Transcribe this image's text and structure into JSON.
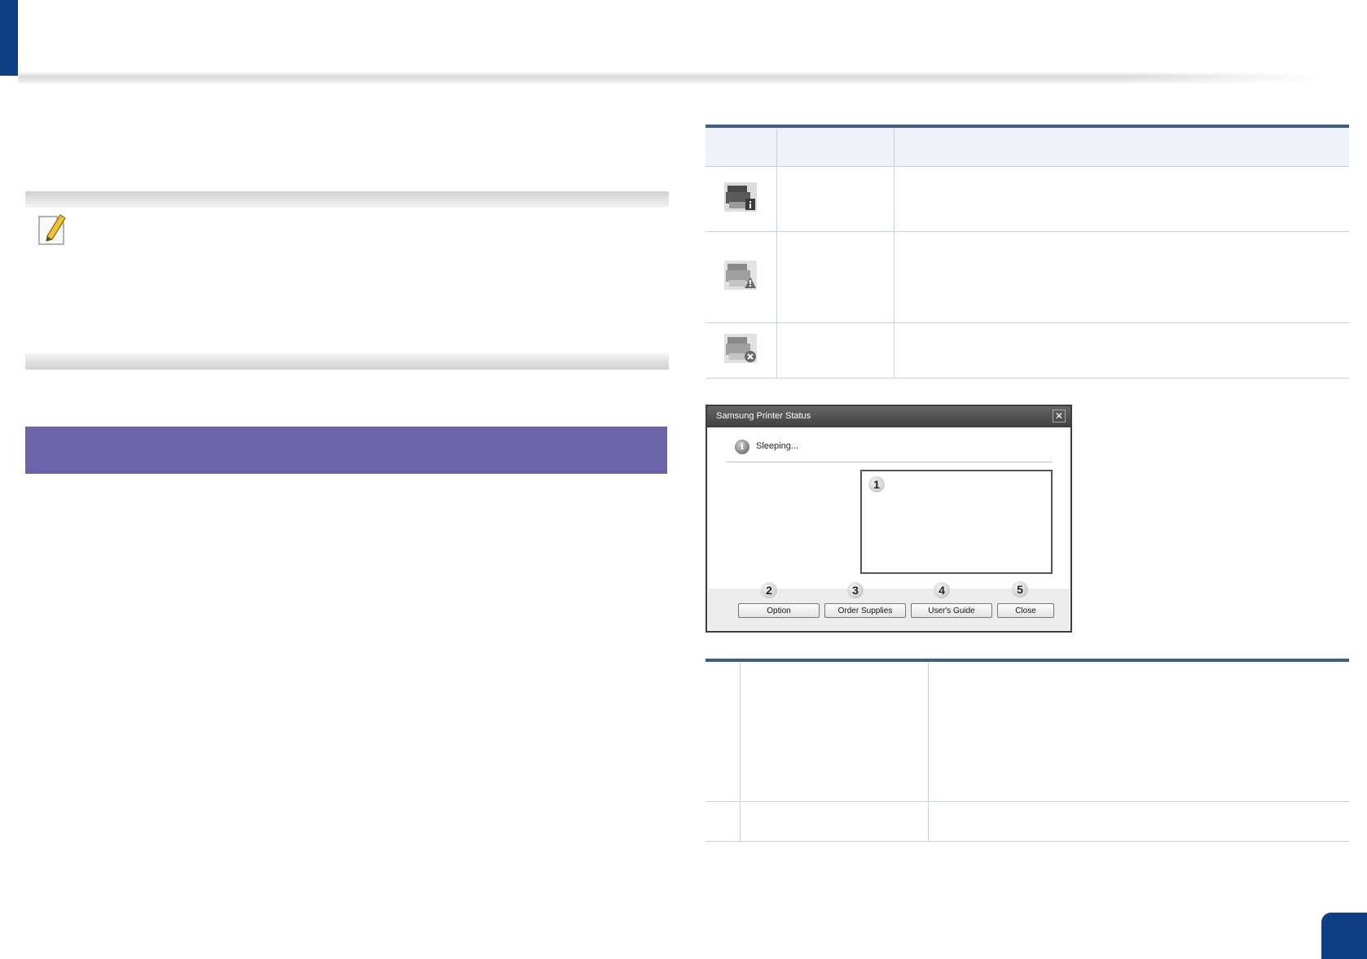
{
  "note": {
    "icon": "note-pencil-icon"
  },
  "status_table": {
    "rows": [
      {
        "icon": "printer-info-icon"
      },
      {
        "icon": "printer-warning-icon"
      },
      {
        "icon": "printer-error-icon"
      }
    ]
  },
  "printer_status_window": {
    "title": "Samsung Printer Status",
    "close_glyph": "✕",
    "status_text": "Sleeping...",
    "status_icon_glyph": "i",
    "callouts": [
      "1",
      "2",
      "3",
      "4",
      "5"
    ],
    "buttons": {
      "option": "Option",
      "order_supplies": "Order Supplies",
      "users_guide": "User's Guide",
      "close": "Close"
    }
  }
}
